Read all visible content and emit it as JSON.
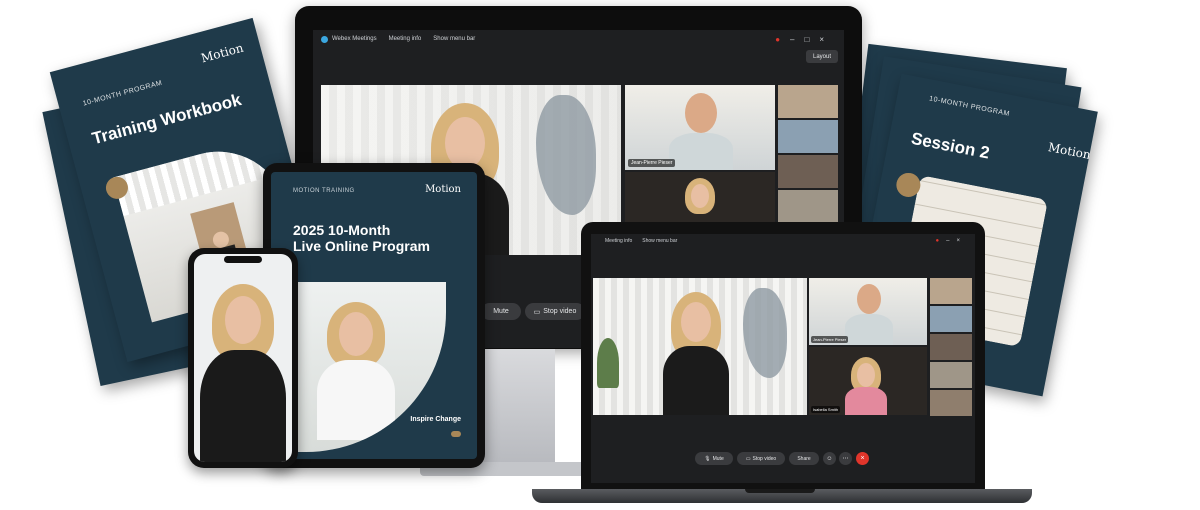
{
  "workbook_left": {
    "program_label": "10-MONTH PROGRAM",
    "title": "Training Workbook",
    "logo": "Motion"
  },
  "workbook_right": {
    "program_label": "10-MONTH PROGRAM",
    "title": "Session 2",
    "logo": "Motion"
  },
  "meeting": {
    "app_title": "Webex Meetings",
    "meeting_info": "Meeting info",
    "show_menu_bar": "Show menu bar",
    "layout_label": "Layout",
    "participant_name_1": "Jean-Pierre Pieser",
    "participant_name_2": "Isabella Smith",
    "mute_label": "Mute",
    "stop_video_label": "Stop video",
    "share_label": "Share"
  },
  "tablet": {
    "eyebrow": "MOTION TRAINING",
    "title_line1": "2025 10-Month",
    "title_line2": "Live Online Program",
    "tagline": "Inspire Change",
    "logo": "Motion"
  },
  "colors": {
    "navy": "#1f3a4a",
    "gold": "#a88758",
    "end_call_red": "#e0352b"
  }
}
